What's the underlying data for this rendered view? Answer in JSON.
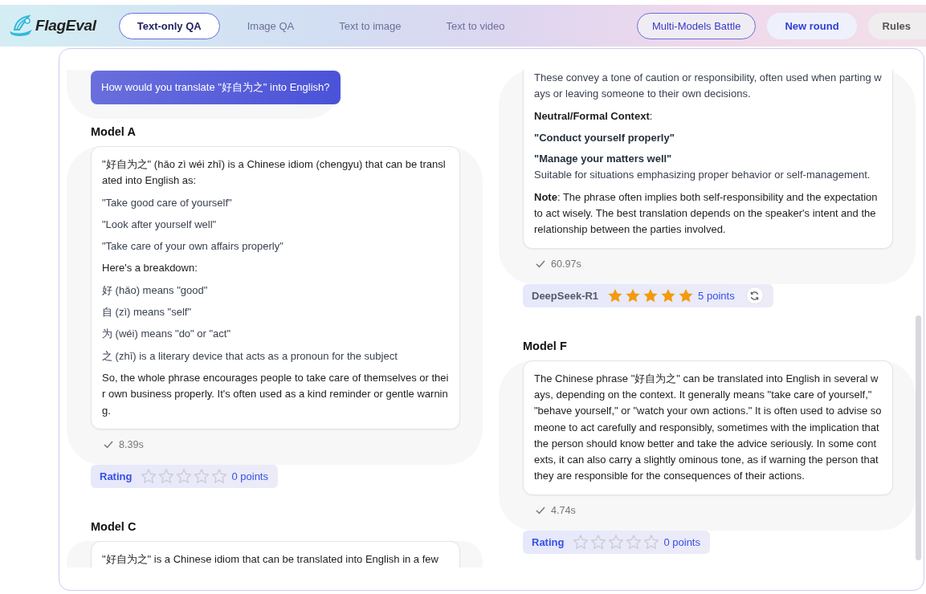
{
  "nav": {
    "logo": "FlagEval",
    "tabs": [
      {
        "label": "Text-only QA",
        "selected": true
      },
      {
        "label": "Image QA",
        "selected": false
      },
      {
        "label": "Text to image",
        "selected": false
      },
      {
        "label": "Text to video",
        "selected": false
      }
    ],
    "buttons": [
      {
        "label": "Multi-Models Battle",
        "kind": "outline"
      },
      {
        "label": "New round",
        "kind": "primary"
      },
      {
        "label": "Rules",
        "kind": "plain"
      }
    ]
  },
  "left": {
    "question": "How would you translate \"好自为之\" into English?",
    "models": [
      {
        "title": "Model A",
        "paragraphs": [
          {
            "kind": "text",
            "text": "\"好自为之\" (hǎo zì wéi zhī) is a Chinese idiom (chengyu) that can be translated into English as:"
          },
          {
            "kind": "item",
            "text": "\"Take good care of yourself\""
          },
          {
            "kind": "item",
            "text": "\"Look after yourself well\""
          },
          {
            "kind": "item",
            "text": "\"Take care of your own affairs properly\""
          },
          {
            "kind": "text",
            "text": "Here's a breakdown:"
          },
          {
            "kind": "item",
            "text": "好 (hǎo) means \"good\""
          },
          {
            "kind": "item",
            "text": "自 (zì) means \"self\""
          },
          {
            "kind": "item",
            "text": "为 (wéi) means \"do\" or \"act\""
          },
          {
            "kind": "item",
            "text": "之 (zhī) is a literary device that acts as a pronoun for the subject"
          },
          {
            "kind": "text",
            "text": "So, the whole phrase encourages people to take care of themselves or their own business properly. It's often used as a kind reminder or gentle warning."
          }
        ],
        "time": "8.39s",
        "rating": {
          "kind": "rating",
          "label": "Rating",
          "stars": 0,
          "points": "0 points"
        }
      },
      {
        "title": "Model C",
        "paragraphs": [
          {
            "kind": "text",
            "text": "\"好自为之\" is a Chinese idiom that can be translated into English in a few"
          }
        ]
      }
    ]
  },
  "right": {
    "models": [
      {
        "paragraphs": [
          {
            "kind": "item",
            "text": "These convey a tone of caution or responsibility, often used when parting ways or leaving someone to their own decisions."
          },
          {
            "kind": "text",
            "text": "**Neutral/Formal Context**:"
          },
          {
            "kind": "heading",
            "text": "\"Conduct yourself properly\""
          },
          {
            "kind": "heading",
            "text": "\"Manage your matters well\""
          },
          {
            "kind": "follow",
            "text": "Suitable for situations emphasizing proper behavior or self-management."
          },
          {
            "kind": "text",
            "text": "**Note**: The phrase often implies both self-responsibility and the expectation to act wisely. The best translation depends on the speaker's intent and the relationship between the parties involved."
          }
        ],
        "time": "60.97s",
        "rating": {
          "kind": "model",
          "label": "DeepSeek-R1",
          "stars": 5,
          "points": "5 points"
        }
      },
      {
        "title": "Model F",
        "paragraphs": [
          {
            "kind": "text",
            "text": "The Chinese phrase \"好自为之\" can be translated into English in several ways, depending on the context. It generally means \"take care of yourself,\" \"behave yourself,\" or \"watch your own actions.\" It is often used to advise someone to act carefully and responsibly, sometimes with the implication that the person should know better and take the advice seriously. In some contexts, it can also carry a slightly ominous tone, as if warning the person that they are responsible for the consequences of their actions."
          }
        ],
        "time": "4.74s",
        "rating": {
          "kind": "rating",
          "label": "Rating",
          "stars": 0,
          "points": "0 points"
        }
      }
    ]
  }
}
